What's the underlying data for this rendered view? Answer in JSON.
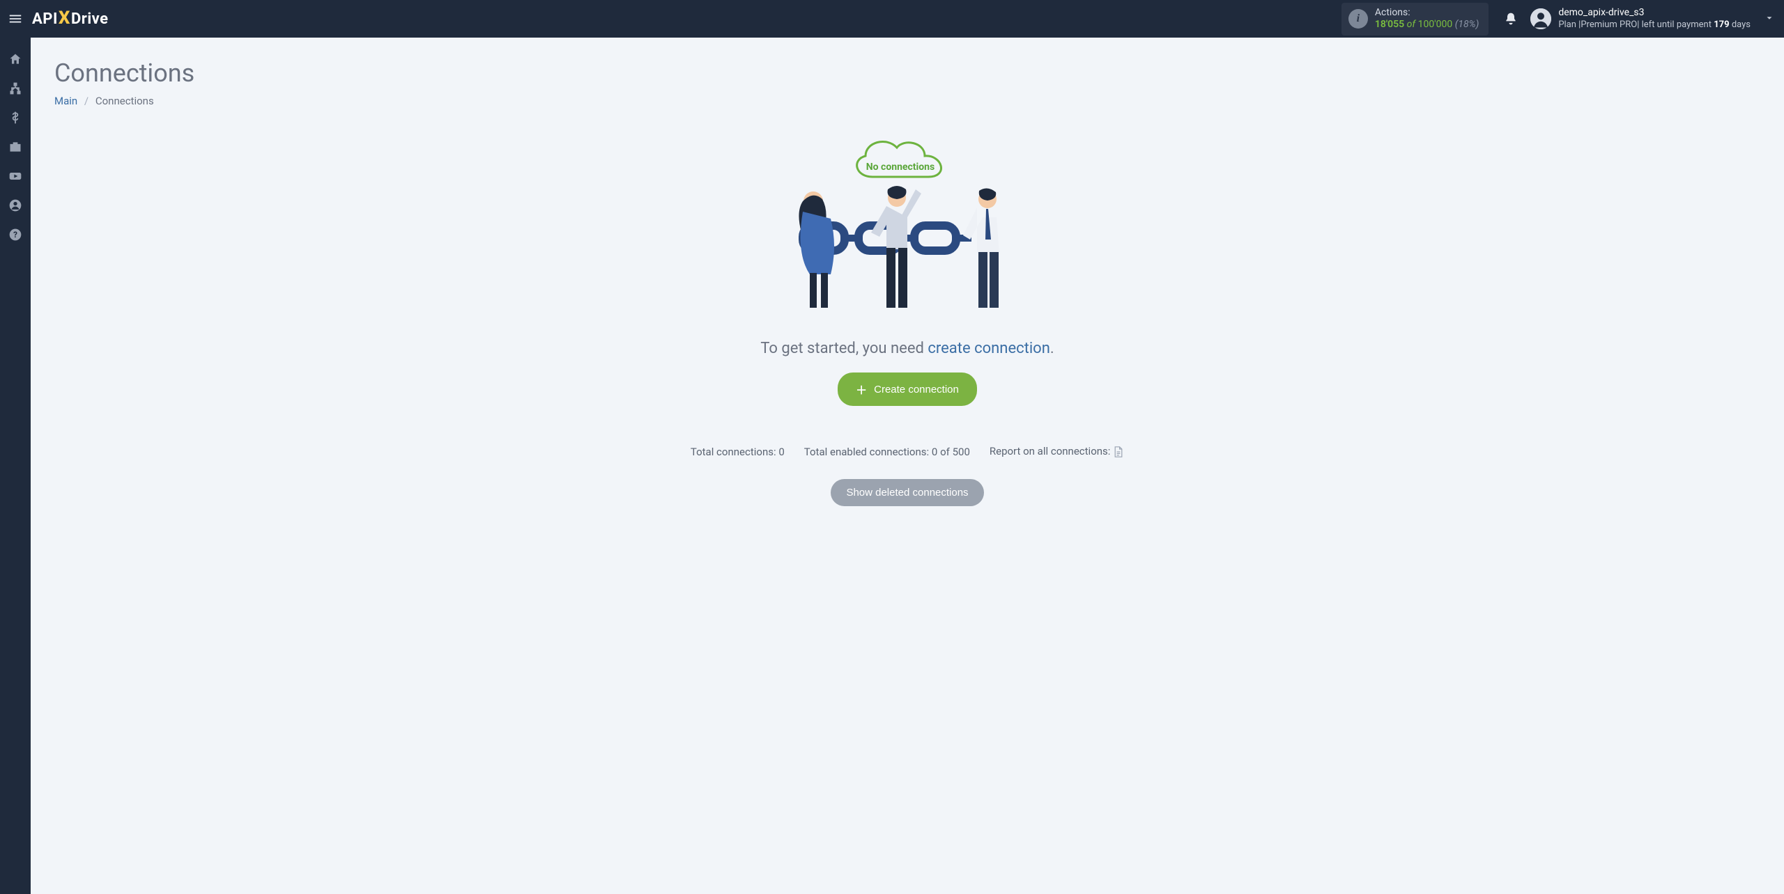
{
  "header": {
    "logo_part1": "API",
    "logo_part2": "Drive",
    "actions": {
      "label": "Actions:",
      "used": "18'055",
      "of_word": "of",
      "total": "100'000",
      "percent": "(18%)"
    },
    "user": {
      "name": "demo_apix-drive_s3",
      "plan_prefix": "Plan |",
      "plan_name": "Premium PRO",
      "plan_suffix": "| left until payment",
      "days_num": "179",
      "days_word": "days"
    }
  },
  "page": {
    "title": "Connections",
    "breadcrumb_main": "Main",
    "breadcrumb_sep": "/",
    "breadcrumb_current": "Connections"
  },
  "empty_state": {
    "cloud_label": "No connections",
    "prompt_prefix": "To get started, you need ",
    "prompt_link": "create connection",
    "prompt_suffix": ".",
    "create_button": "Create connection"
  },
  "stats": {
    "total_label": "Total connections:",
    "total_value": "0",
    "enabled_label": "Total enabled connections:",
    "enabled_value": "0",
    "enabled_of": "of",
    "enabled_max": "500",
    "report_label": "Report on all connections:"
  },
  "buttons": {
    "show_deleted": "Show deleted connections"
  }
}
